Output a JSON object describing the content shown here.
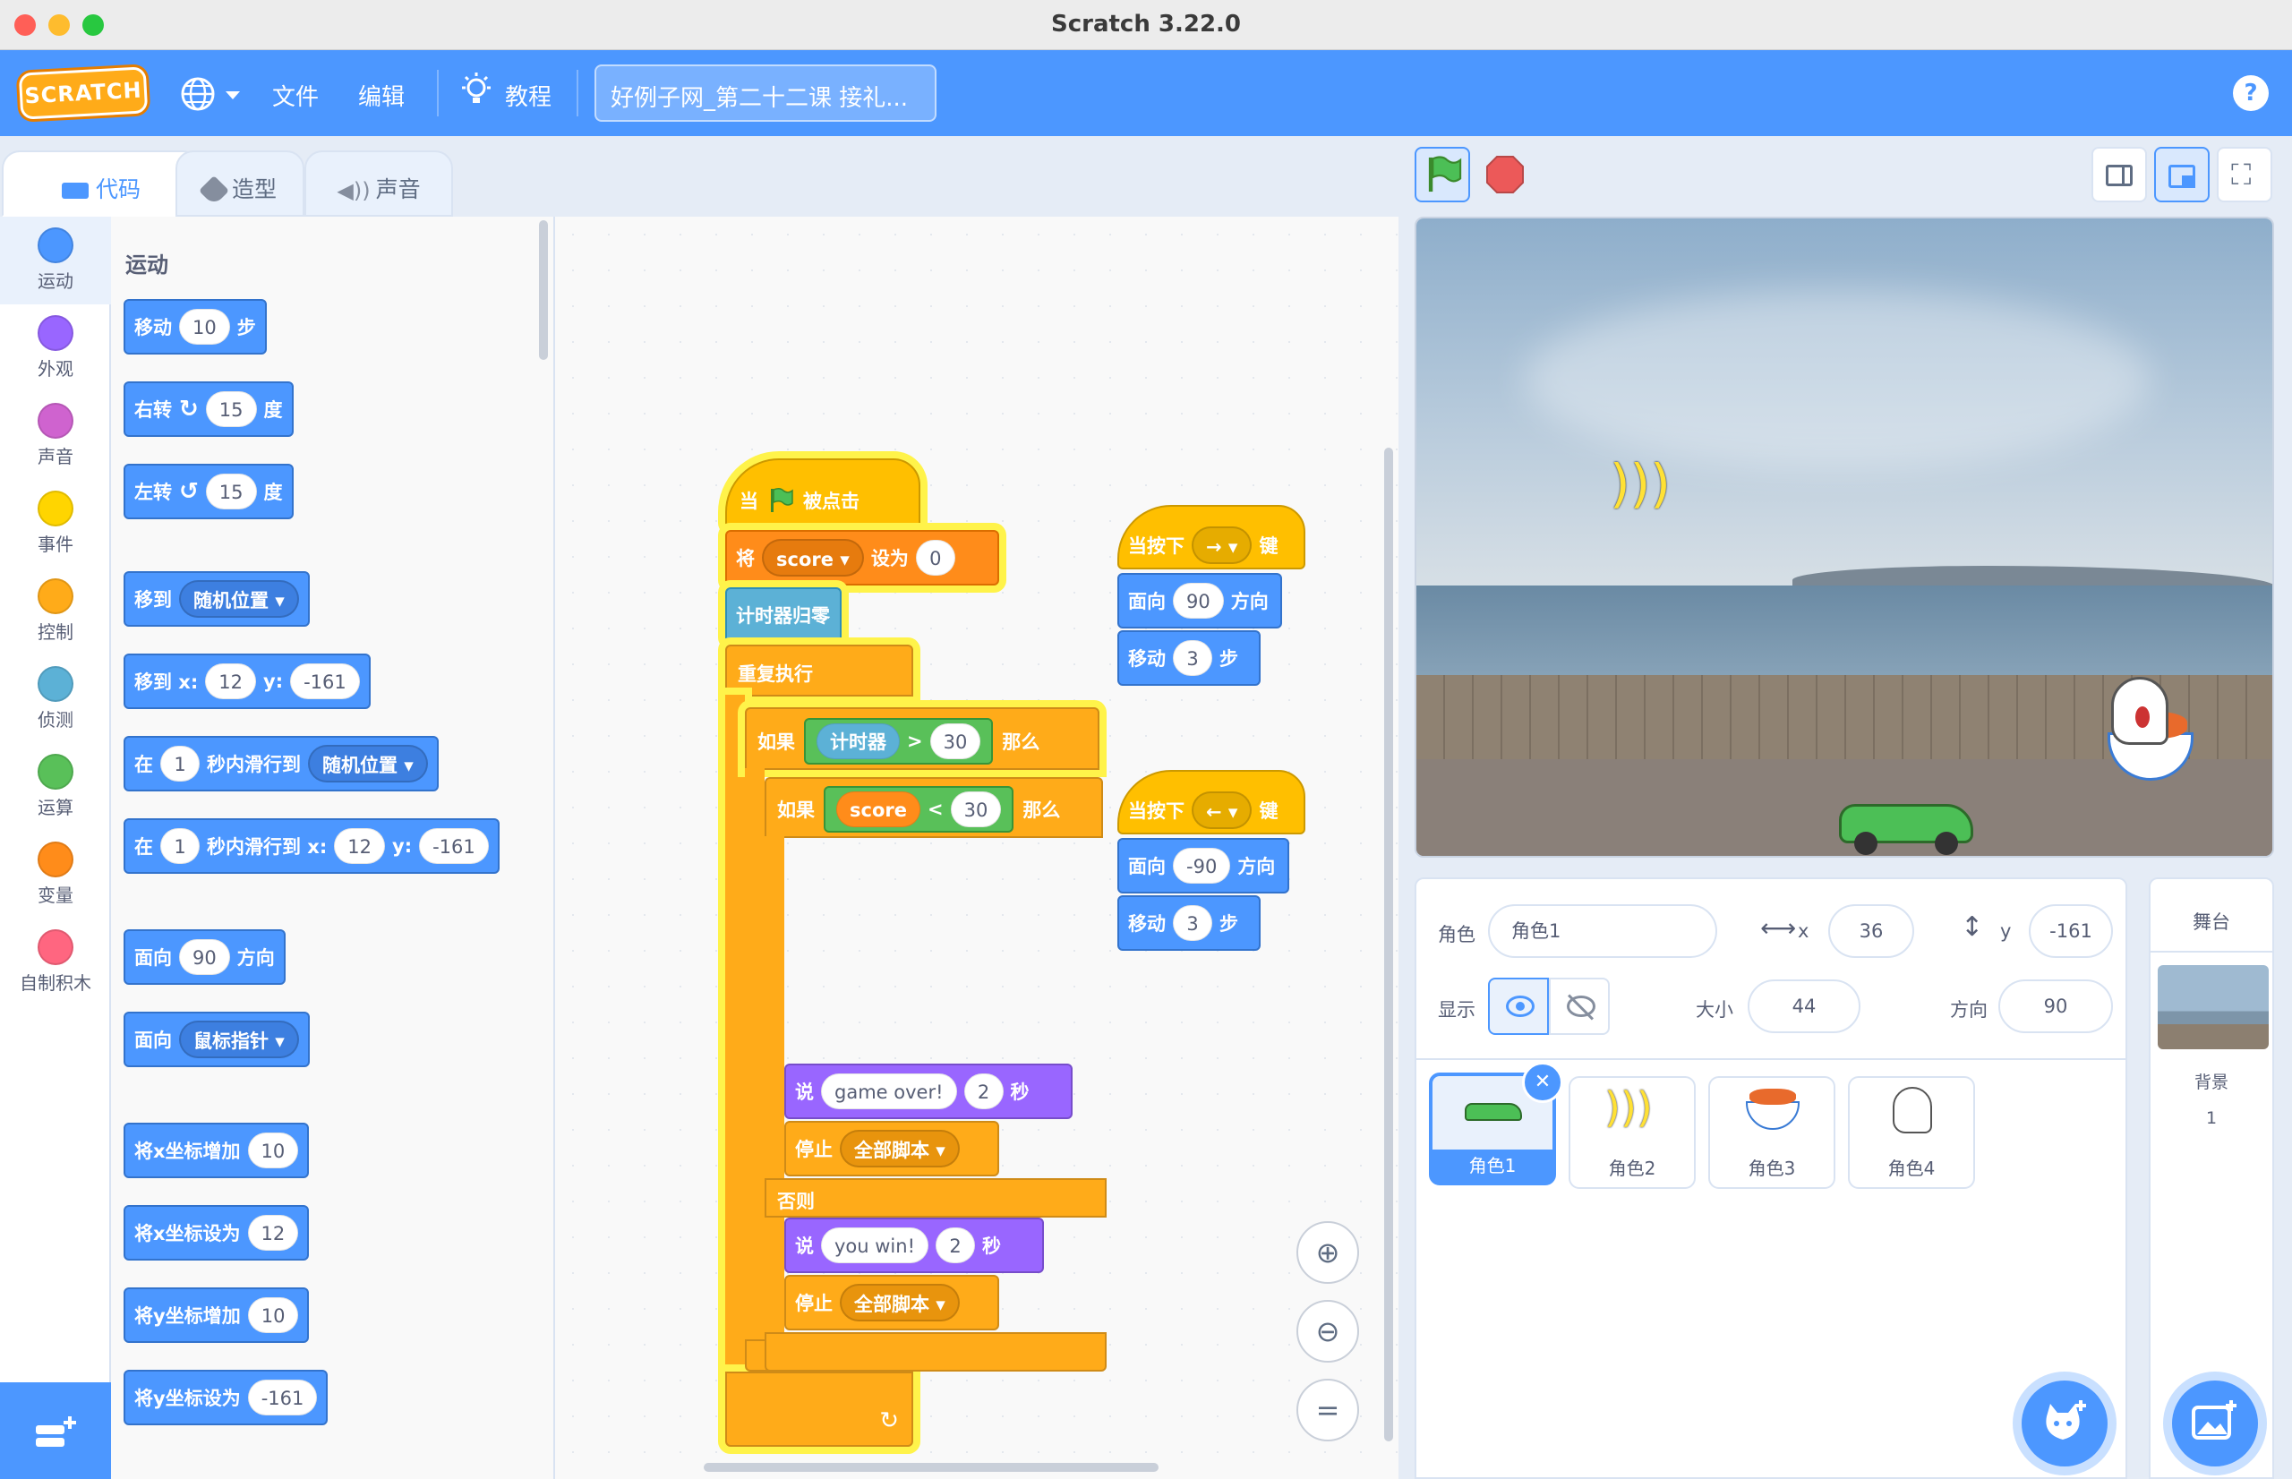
{
  "window": {
    "title": "Scratch 3.22.0"
  },
  "menu": {
    "logo": "SCRATCH",
    "file": "文件",
    "edit": "编辑",
    "tutorials": "教程",
    "project_title": "好例子网_第二十二课 接礼...",
    "icons": [
      "globe-icon",
      "lightbulb-icon",
      "help-icon"
    ]
  },
  "tabs": {
    "code": "代码",
    "costumes": "造型",
    "sounds": "声音"
  },
  "categories": [
    {
      "label": "运动",
      "color": "#4c97ff"
    },
    {
      "label": "外观",
      "color": "#9966ff"
    },
    {
      "label": "声音",
      "color": "#cf63cf"
    },
    {
      "label": "事件",
      "color": "#ffd500"
    },
    {
      "label": "控制",
      "color": "#ffab19"
    },
    {
      "label": "侦测",
      "color": "#5cb1d6"
    },
    {
      "label": "运算",
      "color": "#59c059"
    },
    {
      "label": "变量",
      "color": "#ff8c1a"
    },
    {
      "label": "自制积木",
      "color": "#ff6680"
    }
  ],
  "palette": {
    "title": "运动",
    "move": {
      "a": "移动",
      "v": "10",
      "b": "步"
    },
    "turn_right": {
      "a": "右转",
      "v": "15",
      "b": "度"
    },
    "turn_left": {
      "a": "左转",
      "v": "15",
      "b": "度"
    },
    "goto": {
      "a": "移到",
      "dd": "随机位置"
    },
    "goto_xy": {
      "a": "移到 x:",
      "x": "12",
      "y_label": "y:",
      "y": "-161"
    },
    "glide": {
      "a": "在",
      "v": "1",
      "b": "秒内滑行到",
      "dd": "随机位置"
    },
    "glide_xy": {
      "a": "在",
      "v": "1",
      "b": "秒内滑行到 x:",
      "x": "12",
      "y_label": "y:",
      "y": "-161"
    },
    "point_dir": {
      "a": "面向",
      "v": "90",
      "b": "方向"
    },
    "point_towards": {
      "a": "面向",
      "dd": "鼠标指针"
    },
    "change_x": {
      "a": "将x坐标增加",
      "v": "10"
    },
    "set_x": {
      "a": "将x坐标设为",
      "v": "12"
    },
    "change_y": {
      "a": "将y坐标增加",
      "v": "10"
    },
    "set_y": {
      "a": "将y坐标设为",
      "v": "-161"
    }
  },
  "script": {
    "hat": {
      "a": "当",
      "b": "被点击"
    },
    "set_var": {
      "a": "将",
      "var": "score",
      "b": "设为",
      "v": "0"
    },
    "reset_timer": "计时器归零",
    "forever": "重复执行",
    "if1": {
      "a": "如果",
      "left": "计时器",
      "op": ">",
      "right": "30",
      "b": "那么"
    },
    "if2": {
      "a": "如果",
      "left": "score",
      "op": "<",
      "right": "30",
      "b": "那么"
    },
    "say1": {
      "a": "说",
      "msg": "game over!",
      "secs": "2",
      "b": "秒"
    },
    "stop1": {
      "a": "停止",
      "dd": "全部脚本"
    },
    "else": "否则",
    "say2": {
      "a": "说",
      "msg": "you win!",
      "secs": "2",
      "b": "秒"
    },
    "stop2": {
      "a": "停止",
      "dd": "全部脚本"
    },
    "key_right": {
      "a": "当按下",
      "key": "→",
      "b": "键",
      "dir_a": "面向",
      "dir": "90",
      "dir_b": "方向",
      "mv_a": "移动",
      "mv": "3",
      "mv_b": "步"
    },
    "key_left": {
      "a": "当按下",
      "key": "←",
      "b": "键",
      "dir_a": "面向",
      "dir": "-90",
      "dir_b": "方向",
      "mv_a": "移动",
      "mv": "3",
      "mv_b": "步"
    }
  },
  "sprite_info": {
    "sprite_label": "角色",
    "sprite_name": "角色1",
    "x_label": "x",
    "x": "36",
    "y_label": "y",
    "y": "-161",
    "show_label": "显示",
    "size_label": "大小",
    "size": "44",
    "direction_label": "方向",
    "direction": "90"
  },
  "sprites": [
    "角色1",
    "角色2",
    "角色3",
    "角色4"
  ],
  "stage_panel": {
    "title": "舞台",
    "backdrops_label": "背景",
    "backdrops_count": "1"
  },
  "colors": {
    "accent": "#4c97ff",
    "menubar": "#4c97ff",
    "highlight": "#fff34a"
  }
}
